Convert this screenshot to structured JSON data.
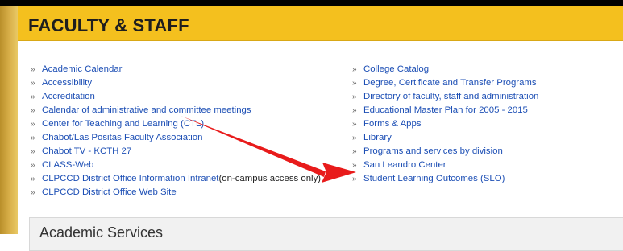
{
  "header": {
    "title": "FACULTY & STAFF"
  },
  "bullet_glyph": "»",
  "left_links": [
    {
      "label": "Academic Calendar"
    },
    {
      "label": "Accessibility"
    },
    {
      "label": "Accreditation"
    },
    {
      "label": "Calendar of administrative and committee meetings"
    },
    {
      "label": "Center for Teaching and Learning (CTL)"
    },
    {
      "label": "Chabot/Las Positas Faculty Association"
    },
    {
      "label": "Chabot TV - KCTH 27"
    },
    {
      "label": "CLASS-Web"
    },
    {
      "label": "CLPCCD District Office Information Intranet",
      "suffix": " (on-campus access only)"
    },
    {
      "label": "CLPCCD District Office Web Site"
    }
  ],
  "right_links": [
    {
      "label": "College Catalog"
    },
    {
      "label": "Degree, Certificate and Transfer Programs"
    },
    {
      "label": "Directory of faculty, staff and administration"
    },
    {
      "label": "Educational Master Plan for 2005 - 2015"
    },
    {
      "label": "Forms & Apps"
    },
    {
      "label": "Library"
    },
    {
      "label": "Programs and services by division"
    },
    {
      "label": "San Leandro Center"
    },
    {
      "label": "Student Learning Outcomes (SLO)"
    }
  ],
  "section": {
    "title": "Academic Services"
  },
  "colors": {
    "header": "#f4c01e",
    "link": "#1d4fb5",
    "arrow": "#e81b1b"
  }
}
